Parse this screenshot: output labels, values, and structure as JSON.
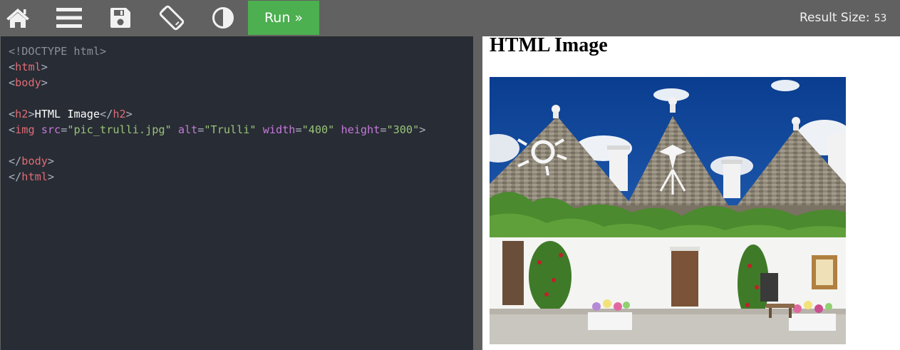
{
  "toolbar": {
    "icons": [
      "home-icon",
      "menu-icon",
      "save-icon",
      "rotate-icon",
      "contrast-icon"
    ],
    "run_label": "Run »",
    "result_size_label": "Result Size:",
    "result_size_value": "53"
  },
  "editor": {
    "doctype": "<!DOCTYPE html>",
    "tag_html": "html",
    "tag_body": "body",
    "tag_h2": "h2",
    "h2_text": "HTML Image",
    "tag_img": "img",
    "attr_src": "src",
    "val_src": "\"pic_trulli.jpg\"",
    "attr_alt": "alt",
    "val_alt": "\"Trulli\"",
    "attr_width": "width",
    "val_width": "\"400\"",
    "attr_height": "height",
    "val_height": "\"300\"",
    "lt": "<",
    "gt": ">",
    "lt_slash": "</",
    "eq": "="
  },
  "result": {
    "heading": "HTML Image",
    "image_alt": "Trulli"
  },
  "colors": {
    "toolbar_bg": "#616161",
    "run_green": "#4caf50",
    "editor_bg": "#282c34",
    "tag": "#e06c75",
    "attr": "#c678dd",
    "value": "#98c379"
  }
}
